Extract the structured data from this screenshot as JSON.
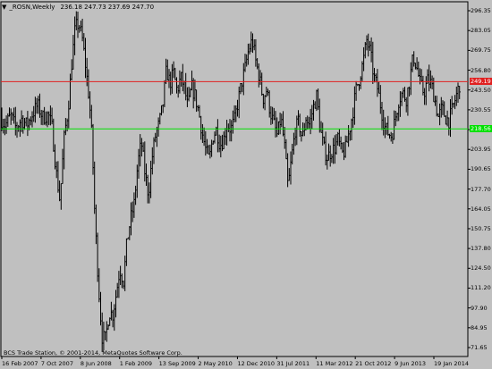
{
  "window": {
    "symbol": "_ROSN,Weekly",
    "ohlc_text": "236.18 247.73 237.69 247.70",
    "copyright": "BCS Trade Station, © 2001-2014, MetaQuotes Software Corp."
  },
  "colors": {
    "background": "#c0c0c0",
    "bars": "#000000",
    "resistance": "#e02020",
    "support": "#00e000"
  },
  "lines": {
    "resistance": {
      "price": 249.19,
      "label": "249.19"
    },
    "support": {
      "price": 218.56,
      "label": "218.56"
    }
  },
  "chart_data": {
    "type": "ohlc",
    "title": "_ROSN,Weekly",
    "ylim": [
      71.0,
      301.0
    ],
    "y_ticks": [
      "296.35",
      "283.05",
      "269.75",
      "256.80",
      "243.50",
      "230.55",
      "217.25",
      "203.95",
      "190.65",
      "177.70",
      "164.05",
      "150.75",
      "137.80",
      "124.50",
      "111.20",
      "97.90",
      "84.95",
      "71.65"
    ],
    "x_labels": [
      "16 Feb 2007",
      "7 Oct 2007",
      "8 Jun 2008",
      "1 Feb 2009",
      "13 Sep 2009",
      "2 May 2010",
      "12 Dec 2010",
      "31 Jul 2011",
      "11 Mar 2012",
      "21 Oct 2012",
      "9 Jun 2013",
      "19 Jan 2014"
    ],
    "series_close": [
      [
        0,
        226
      ],
      [
        6,
        221
      ],
      [
        12,
        227
      ],
      [
        18,
        219
      ],
      [
        24,
        225
      ],
      [
        30,
        221
      ],
      [
        36,
        228
      ],
      [
        42,
        234
      ],
      [
        48,
        226
      ],
      [
        54,
        228
      ],
      [
        58,
        220
      ],
      [
        63,
        190
      ],
      [
        67,
        172
      ],
      [
        72,
        215
      ],
      [
        76,
        230
      ],
      [
        80,
        260
      ],
      [
        84,
        284
      ],
      [
        88,
        287
      ],
      [
        92,
        277
      ],
      [
        96,
        258
      ],
      [
        100,
        236
      ],
      [
        103,
        210
      ],
      [
        106,
        162
      ],
      [
        110,
        118
      ],
      [
        114,
        84
      ],
      [
        118,
        82
      ],
      [
        122,
        100
      ],
      [
        126,
        98
      ],
      [
        130,
        112
      ],
      [
        134,
        128
      ],
      [
        138,
        120
      ],
      [
        142,
        146
      ],
      [
        146,
        160
      ],
      [
        150,
        170
      ],
      [
        154,
        196
      ],
      [
        158,
        210
      ],
      [
        162,
        190
      ],
      [
        166,
        176
      ],
      [
        170,
        200
      ],
      [
        174,
        215
      ],
      [
        178,
        222
      ],
      [
        182,
        234
      ],
      [
        186,
        257
      ],
      [
        190,
        248
      ],
      [
        194,
        255
      ],
      [
        198,
        243
      ],
      [
        202,
        252
      ],
      [
        206,
        246
      ],
      [
        210,
        232
      ],
      [
        214,
        246
      ],
      [
        218,
        240
      ],
      [
        222,
        230
      ],
      [
        226,
        216
      ],
      [
        230,
        205
      ],
      [
        234,
        198
      ],
      [
        238,
        214
      ],
      [
        242,
        218
      ],
      [
        246,
        208
      ],
      [
        250,
        212
      ],
      [
        254,
        222
      ],
      [
        258,
        218
      ],
      [
        262,
        224
      ],
      [
        266,
        236
      ],
      [
        270,
        248
      ],
      [
        274,
        258
      ],
      [
        278,
        270
      ],
      [
        282,
        276
      ],
      [
        286,
        262
      ],
      [
        290,
        252
      ],
      [
        294,
        238
      ],
      [
        298,
        244
      ],
      [
        302,
        230
      ],
      [
        306,
        222
      ],
      [
        310,
        214
      ],
      [
        314,
        226
      ],
      [
        318,
        208
      ],
      [
        322,
        180
      ],
      [
        326,
        200
      ],
      [
        330,
        218
      ],
      [
        334,
        223
      ],
      [
        338,
        212
      ],
      [
        342,
        226
      ],
      [
        346,
        221
      ],
      [
        350,
        232
      ],
      [
        354,
        240
      ],
      [
        358,
        218
      ],
      [
        362,
        206
      ],
      [
        366,
        200
      ],
      [
        370,
        204
      ],
      [
        374,
        206
      ],
      [
        378,
        212
      ],
      [
        382,
        202
      ],
      [
        386,
        205
      ],
      [
        390,
        216
      ],
      [
        394,
        228
      ],
      [
        398,
        244
      ],
      [
        402,
        252
      ],
      [
        406,
        262
      ],
      [
        410,
        276
      ],
      [
        414,
        268
      ],
      [
        418,
        252
      ],
      [
        422,
        245
      ],
      [
        426,
        232
      ],
      [
        430,
        220
      ],
      [
        434,
        216
      ],
      [
        438,
        214
      ],
      [
        442,
        226
      ],
      [
        446,
        238
      ],
      [
        450,
        242
      ],
      [
        454,
        238
      ],
      [
        458,
        250
      ],
      [
        462,
        266
      ],
      [
        466,
        258
      ],
      [
        470,
        247
      ],
      [
        474,
        242
      ],
      [
        478,
        250
      ],
      [
        482,
        248
      ],
      [
        486,
        238
      ],
      [
        490,
        226
      ],
      [
        494,
        232
      ],
      [
        498,
        226
      ],
      [
        502,
        224
      ],
      [
        506,
        232
      ],
      [
        510,
        240
      ],
      [
        514,
        248
      ]
    ]
  }
}
